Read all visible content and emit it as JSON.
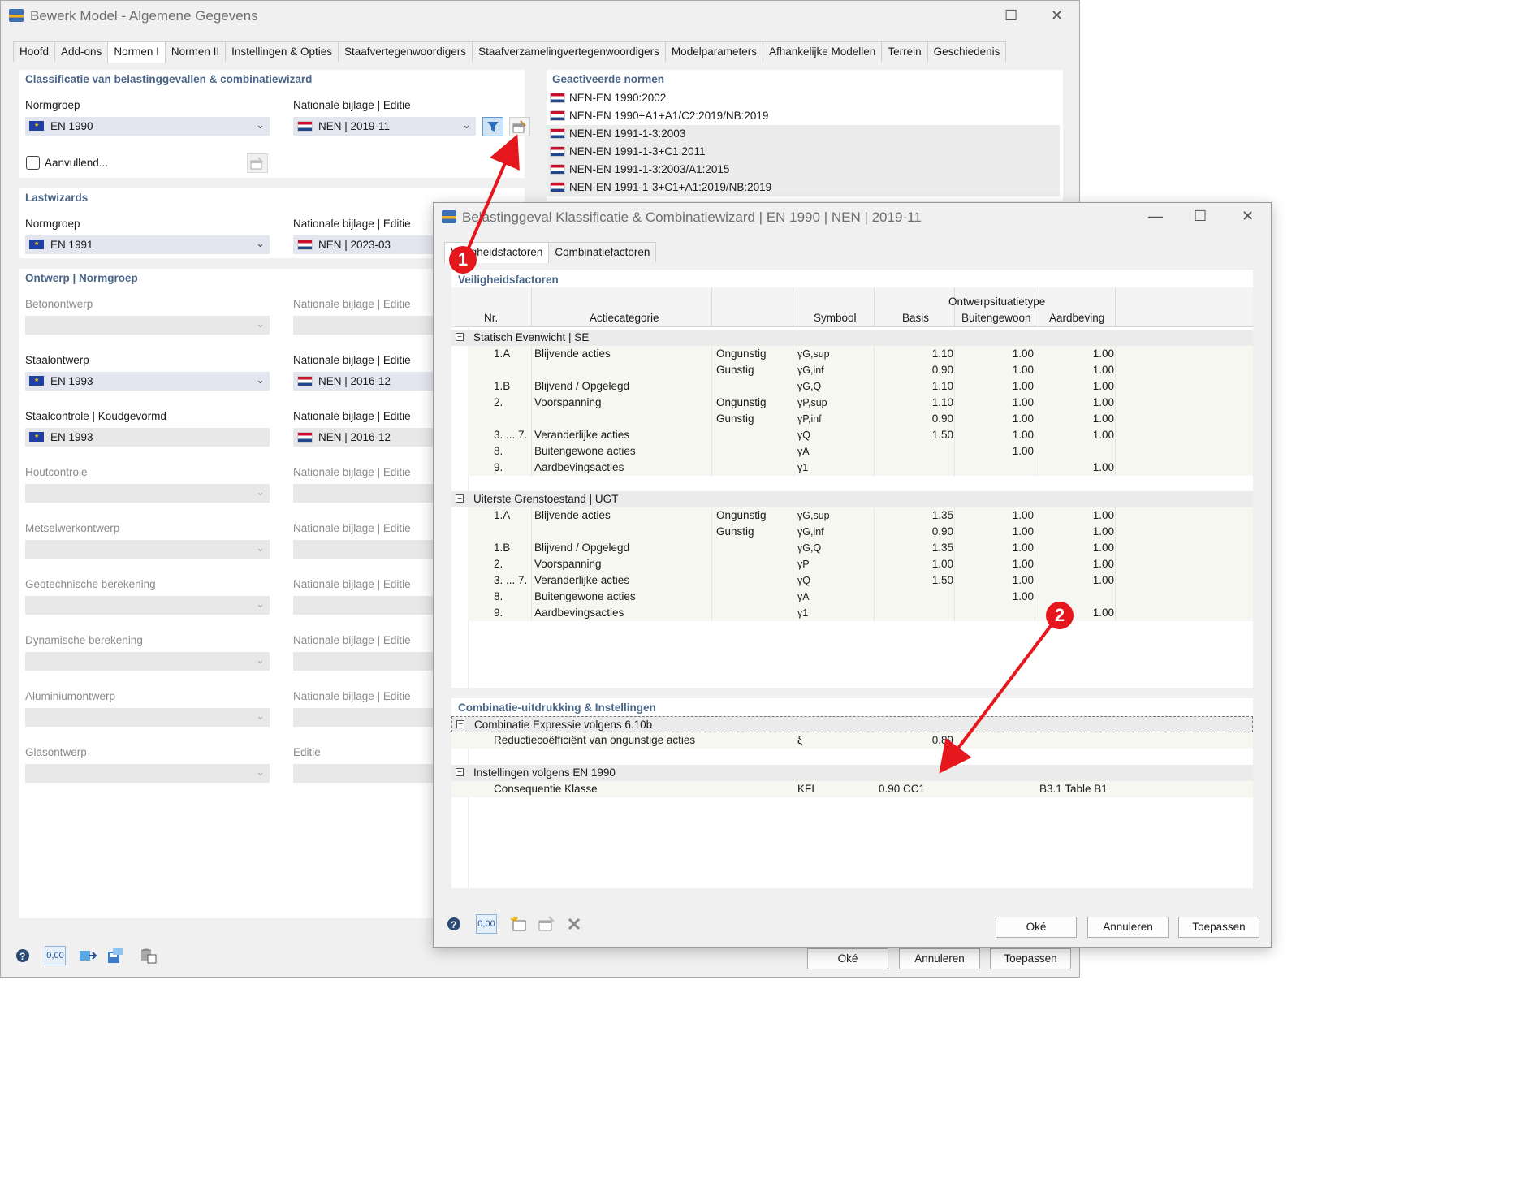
{
  "main": {
    "title": "Bewerk Model - Algemene Gegevens",
    "tabs": [
      "Hoofd",
      "Add-ons",
      "Normen I",
      "Normen II",
      "Instellingen & Opties",
      "Staafvertegenwoordigers",
      "Staafverzamelingvertegenwoordigers",
      "Modelparameters",
      "Afhankelijke Modellen",
      "Terrein",
      "Geschiedenis"
    ],
    "classification": {
      "heading": "Classificatie van belastinggevallen & combinatiewizard",
      "normgroup_label": "Normgroep",
      "normgroup_value": "EN 1990",
      "annex_label": "Nationale bijlage | Editie",
      "annex_value": "NEN | 2019-11",
      "supplementary_label": "Aanvullend..."
    },
    "activated": {
      "heading": "Geactiveerde normen",
      "items": [
        "NEN-EN 1990:2002",
        "NEN-EN 1990+A1+A1/C2:2019/NB:2019",
        "NEN-EN 1991-1-3:2003",
        "NEN-EN 1991-1-3+C1:2011",
        "NEN-EN 1991-1-3:2003/A1:2015",
        "NEN-EN 1991-1-3+C1+A1:2019/NB:2019"
      ]
    },
    "loadwizards": {
      "heading": "Lastwizards",
      "normgroup_label": "Normgroep",
      "normgroup_value": "EN 1991",
      "annex_label": "Nationale bijlage | Editie",
      "annex_value": "NEN | 2023-03"
    },
    "design": {
      "heading": "Ontwerp | Normgroep",
      "rows": [
        {
          "label": "Betonontwerp",
          "annex_label": "Nationale bijlage | Editie",
          "value": "",
          "annex": "",
          "enabled": false
        },
        {
          "label": "Staalontwerp",
          "annex_label": "Nationale bijlage | Editie",
          "value": "EN 1993",
          "annex": "NEN | 2016-12",
          "enabled": true
        },
        {
          "label": "Staalcontrole | Koudgevormd",
          "annex_label": "Nationale bijlage | Editie",
          "value": "EN 1993",
          "annex": "NEN | 2016-12",
          "enabled": true
        },
        {
          "label": "Houtcontrole",
          "annex_label": "Nationale bijlage | Editie",
          "value": "",
          "annex": "",
          "enabled": false
        },
        {
          "label": "Metselwerkontwerp",
          "annex_label": "Nationale bijlage | Editie",
          "value": "",
          "annex": "",
          "enabled": false
        },
        {
          "label": "Geotechnische berekening",
          "annex_label": "Nationale bijlage | Editie",
          "value": "",
          "annex": "",
          "enabled": false
        },
        {
          "label": "Dynamische berekening",
          "annex_label": "Nationale bijlage | Editie",
          "value": "",
          "annex": "",
          "enabled": false
        },
        {
          "label": "Aluminiumontwerp",
          "annex_label": "Nationale bijlage | Editie",
          "value": "",
          "annex": "",
          "enabled": false
        },
        {
          "label": "Glasontwerp",
          "annex_label": "Editie",
          "value": "",
          "annex": "",
          "enabled": false
        }
      ]
    },
    "buttons": {
      "ok": "Oké",
      "cancel": "Annuleren",
      "apply": "Toepassen"
    },
    "toolbar_number": "0,00"
  },
  "dialog": {
    "title": "Belastinggeval Klassificatie & Combinatiewizard | EN 1990 | NEN | 2019-11",
    "tabs": [
      "Veiligheidsfactoren",
      "Combinatiefactoren"
    ],
    "safety": {
      "heading": "Veiligheidsfactoren",
      "columns": {
        "nr": "Nr.",
        "category": "Actiecategorie",
        "symbol": "Symbool",
        "group": "Ontwerpsituatietype",
        "basis": "Basis",
        "extra": "Buitengewoon",
        "quake": "Aardbeving"
      },
      "groups": [
        {
          "title": "Statisch Evenwicht | SE",
          "rows": [
            {
              "nr": "1.A",
              "cat": "Blijvende acties",
              "eff": "Ongunstig",
              "sym": "γG,sup",
              "b": "1.10",
              "e": "1.00",
              "q": "1.00"
            },
            {
              "nr": "",
              "cat": "",
              "eff": "Gunstig",
              "sym": "γG,inf",
              "b": "0.90",
              "e": "1.00",
              "q": "1.00"
            },
            {
              "nr": "1.B",
              "cat": "Blijvend / Opgelegd",
              "eff": "",
              "sym": "γG,Q",
              "b": "1.10",
              "e": "1.00",
              "q": "1.00"
            },
            {
              "nr": "2.",
              "cat": "Voorspanning",
              "eff": "Ongunstig",
              "sym": "γP,sup",
              "b": "1.10",
              "e": "1.00",
              "q": "1.00"
            },
            {
              "nr": "",
              "cat": "",
              "eff": "Gunstig",
              "sym": "γP,inf",
              "b": "0.90",
              "e": "1.00",
              "q": "1.00"
            },
            {
              "nr": "3. ... 7.",
              "cat": "Veranderlijke acties",
              "eff": "",
              "sym": "γQ",
              "b": "1.50",
              "e": "1.00",
              "q": "1.00"
            },
            {
              "nr": "8.",
              "cat": "Buitengewone acties",
              "eff": "",
              "sym": "γA",
              "b": "",
              "e": "1.00",
              "q": ""
            },
            {
              "nr": "9.",
              "cat": "Aardbevingsacties",
              "eff": "",
              "sym": "γ1",
              "b": "",
              "e": "",
              "q": "1.00"
            }
          ]
        },
        {
          "title": "Uiterste Grenstoestand | UGT",
          "rows": [
            {
              "nr": "1.A",
              "cat": "Blijvende acties",
              "eff": "Ongunstig",
              "sym": "γG,sup",
              "b": "1.35",
              "e": "1.00",
              "q": "1.00"
            },
            {
              "nr": "",
              "cat": "",
              "eff": "Gunstig",
              "sym": "γG,inf",
              "b": "0.90",
              "e": "1.00",
              "q": "1.00"
            },
            {
              "nr": "1.B",
              "cat": "Blijvend / Opgelegd",
              "eff": "",
              "sym": "γG,Q",
              "b": "1.35",
              "e": "1.00",
              "q": "1.00"
            },
            {
              "nr": "2.",
              "cat": "Voorspanning",
              "eff": "",
              "sym": "γP",
              "b": "1.00",
              "e": "1.00",
              "q": "1.00"
            },
            {
              "nr": "3. ... 7.",
              "cat": "Veranderlijke acties",
              "eff": "",
              "sym": "γQ",
              "b": "1.50",
              "e": "1.00",
              "q": "1.00"
            },
            {
              "nr": "8.",
              "cat": "Buitengewone acties",
              "eff": "",
              "sym": "γA",
              "b": "",
              "e": "1.00",
              "q": ""
            },
            {
              "nr": "9.",
              "cat": "Aardbevingsacties",
              "eff": "",
              "sym": "γ1",
              "b": "",
              "e": "",
              "q": "1.00"
            }
          ]
        }
      ]
    },
    "combination": {
      "heading": "Combinatie-uitdrukking & Instellingen",
      "group1": "Combinatie Expressie volgens 6.10b",
      "row1_label": "Reductiecoëfficiënt van ongunstige acties",
      "row1_symbol": "ξ",
      "row1_value": "0.89",
      "group2": "Instellingen volgens EN 1990",
      "row2_label": "Consequentie Klasse",
      "row2_symbol": "KFI",
      "row2_value": "0.90 CC1",
      "row2_ref": "B3.1 Table B1"
    },
    "buttons": {
      "ok": "Oké",
      "cancel": "Annuleren",
      "apply": "Toepassen"
    },
    "toolbar_number": "0,00"
  },
  "annotations": {
    "marker1": "1",
    "marker2": "2"
  },
  "colors": {
    "accent_heading": "#4a6487",
    "marker": "#e5161c",
    "selected_tab": "#ffffff",
    "combo_bg": "#e3e6ef"
  }
}
